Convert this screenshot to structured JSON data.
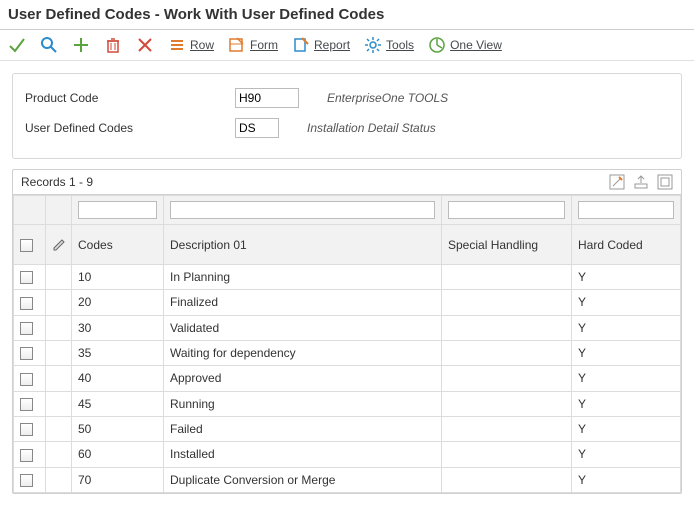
{
  "title": "User Defined Codes - Work With User Defined Codes",
  "toolbar": {
    "row_label": "Row",
    "form_label": "Form",
    "report_label": "Report",
    "tools_label": "Tools",
    "oneview_label": "One View"
  },
  "form": {
    "product_code_label": "Product Code",
    "product_code_value": "H90",
    "product_code_desc": "EnterpriseOne TOOLS",
    "udc_label": "User Defined Codes",
    "udc_value": "DS",
    "udc_desc": "Installation Detail Status"
  },
  "grid": {
    "records_label": "Records 1 - 9",
    "columns": {
      "codes": "Codes",
      "description": "Description 01",
      "special": "Special Handling",
      "hard": "Hard Coded"
    },
    "rows": [
      {
        "code": "10",
        "desc": "In Planning",
        "special": "",
        "hard": "Y"
      },
      {
        "code": "20",
        "desc": "Finalized",
        "special": "",
        "hard": "Y"
      },
      {
        "code": "30",
        "desc": "Validated",
        "special": "",
        "hard": "Y"
      },
      {
        "code": "35",
        "desc": "Waiting for dependency",
        "special": "",
        "hard": "Y"
      },
      {
        "code": "40",
        "desc": "Approved",
        "special": "",
        "hard": "Y"
      },
      {
        "code": "45",
        "desc": "Running",
        "special": "",
        "hard": "Y"
      },
      {
        "code": "50",
        "desc": "Failed",
        "special": "",
        "hard": "Y"
      },
      {
        "code": "60",
        "desc": "Installed",
        "special": "",
        "hard": "Y"
      },
      {
        "code": "70",
        "desc": "Duplicate Conversion or Merge",
        "special": "",
        "hard": "Y"
      }
    ]
  }
}
